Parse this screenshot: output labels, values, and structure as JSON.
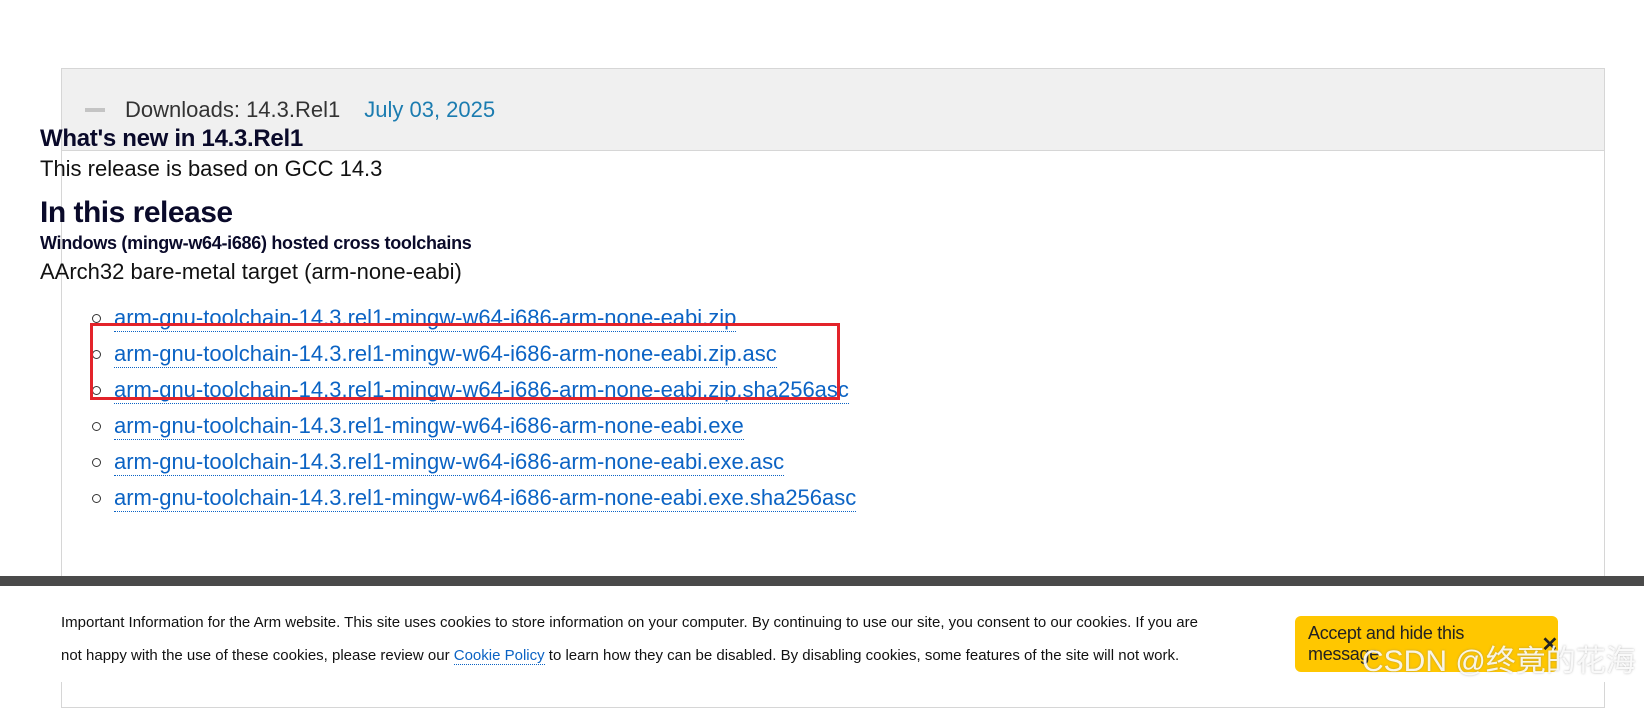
{
  "downloads": {
    "title": "Downloads: 14.3.Rel1",
    "date": "July 03, 2025",
    "collapse_icon": "minus-icon"
  },
  "content": {
    "whats_new_heading": "What's new in 14.3.Rel1",
    "based_on": "This release is based on GCC 14.3",
    "in_release_heading": "In this release",
    "host_heading": "Windows (mingw-w64-i686) hosted cross toolchains",
    "target_label": "AArch32 bare-metal target (arm-none-eabi)",
    "files": [
      "arm-gnu-toolchain-14.3.rel1-mingw-w64-i686-arm-none-eabi.zip",
      "arm-gnu-toolchain-14.3.rel1-mingw-w64-i686-arm-none-eabi.zip.asc",
      "arm-gnu-toolchain-14.3.rel1-mingw-w64-i686-arm-none-eabi.zip.sha256asc",
      "arm-gnu-toolchain-14.3.rel1-mingw-w64-i686-arm-none-eabi.exe",
      "arm-gnu-toolchain-14.3.rel1-mingw-w64-i686-arm-none-eabi.exe.asc",
      "arm-gnu-toolchain-14.3.rel1-mingw-w64-i686-arm-none-eabi.exe.sha256asc"
    ]
  },
  "cookie": {
    "text_before": "Important Information for the Arm website. This site uses cookies to store information on your computer. By continuing to use our site, you consent to our cookies. If you are not happy with the use of these cookies, please review our ",
    "link": "Cookie Policy",
    "text_after": " to learn how they can be disabled. By disabling cookies, some features of the site will not work.",
    "accept_label": "Accept and hide this message",
    "close_glyph": "✕",
    "close_icon": "close-icon"
  },
  "watermark": "CSDN @终竟的花海",
  "colors": {
    "link": "#0b63c4",
    "date": "#1b7cb0",
    "accept_button": "#ffc700",
    "highlight_border": "#e3232a",
    "header_bg": "#f0f0f0"
  }
}
